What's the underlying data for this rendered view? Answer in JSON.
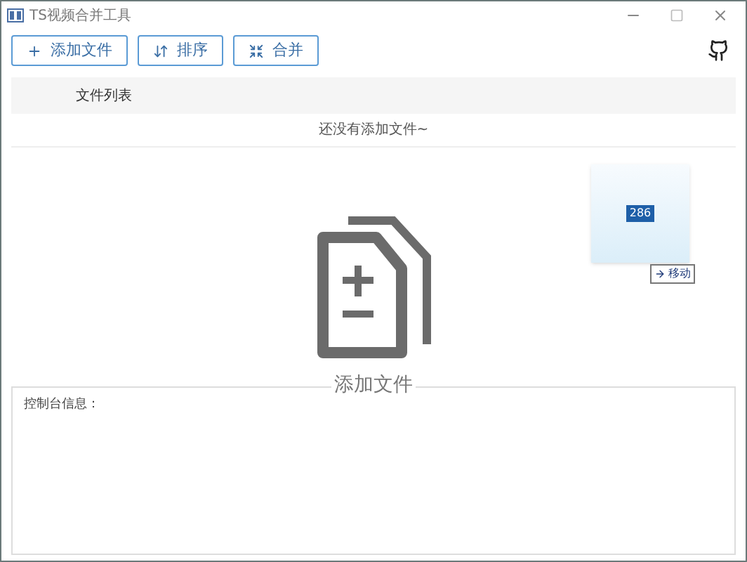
{
  "window": {
    "title": "TS视频合并工具"
  },
  "toolbar": {
    "buttons": [
      {
        "label": "添加文件",
        "kind": "add"
      },
      {
        "label": "排序",
        "kind": "sort"
      },
      {
        "label": "合并",
        "kind": "merge"
      }
    ]
  },
  "file_list": {
    "header": "文件列表",
    "empty_message": "还没有添加文件~"
  },
  "drop_zone": {
    "label": "添加文件",
    "drag_preview": {
      "badge": "286",
      "tooltip": "移动"
    }
  },
  "console": {
    "label": "控制台信息："
  }
}
